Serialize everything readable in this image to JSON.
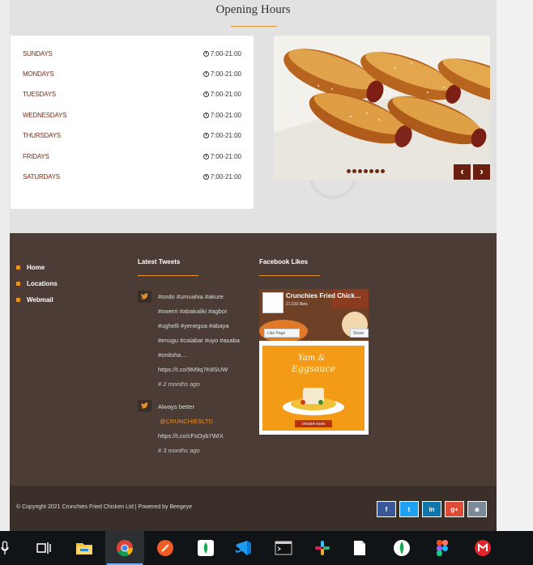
{
  "section_title": "Opening Hours",
  "hours": [
    {
      "day": "SUNDAYS",
      "time": "7:00-21:00"
    },
    {
      "day": "MONDAYS",
      "time": "7:00-21:00"
    },
    {
      "day": "TUESDAYS",
      "time": "7:00-21:00"
    },
    {
      "day": "WEDNESDAYS",
      "time": "7:00-21:00"
    },
    {
      "day": "THURSDAYS",
      "time": "7:00-21:00"
    },
    {
      "day": "FRIDAYS",
      "time": "7:00-21:00"
    },
    {
      "day": "SATURDAYS",
      "time": "7:00-21:00"
    }
  ],
  "slider": {
    "prev": "‹",
    "next": "›",
    "slide_count": 7
  },
  "footer": {
    "nav": [
      {
        "label": "Home"
      },
      {
        "label": "Locations"
      },
      {
        "label": "Webmail"
      }
    ],
    "tweets_heading": "Latest Tweets",
    "tweets": [
      {
        "lines": [
          "#ondo #umuahia #akure",
          "#owerri #abakaliki #agbor",
          "#ughelli #yenegoa #abaya",
          "#enugu #calabar #uyo #asaba",
          "#onitsha…",
          "https://t.co/9M9q7K8SUW"
        ],
        "ago": "# 2 months ago"
      },
      {
        "lines": [
          "Always better",
          "@CRUNCHIESLTD",
          "https://t.co/cFsOyb7WIX"
        ],
        "ago": "# 3 months ago"
      }
    ],
    "facebook_heading": "Facebook Likes",
    "facebook": {
      "page_name": "Crunchies Fried Chick…",
      "likes": "21,510 likes",
      "like_button": "Like Page",
      "share_button": "Share",
      "post_title_1": "Yam &",
      "post_title_2": "Eggsauce",
      "post_button": "ORDER NOW"
    }
  },
  "bottom": {
    "copyright": "© Copyright 2021 Crunchies Fried Chicken Ltd | Powered by Beegeye",
    "social": [
      {
        "name": "facebook",
        "glyph": "f",
        "color": "#3b5998"
      },
      {
        "name": "twitter",
        "glyph": "t",
        "color": "#1da1f2"
      },
      {
        "name": "linkedin",
        "glyph": "in",
        "color": "#0e76a8"
      },
      {
        "name": "google-plus",
        "glyph": "g+",
        "color": "#dd4b39"
      },
      {
        "name": "instagram",
        "glyph": "◙",
        "color": "#7a8a99"
      }
    ]
  },
  "taskbar": [
    {
      "name": "task-view-icon"
    },
    {
      "name": "file-explorer-icon"
    },
    {
      "name": "chrome-icon",
      "active": true
    },
    {
      "name": "postman-icon"
    },
    {
      "name": "mongodb-compass-icon"
    },
    {
      "name": "vscode-icon"
    },
    {
      "name": "terminal-icon"
    },
    {
      "name": "slack-icon"
    },
    {
      "name": "notepad-icon"
    },
    {
      "name": "mongodb-icon"
    },
    {
      "name": "figma-icon"
    },
    {
      "name": "gmail-icon"
    }
  ],
  "colors": {
    "accent": "#e8902b",
    "maroon": "#7a2b14",
    "footer_bg": "#4b3d36",
    "bottom_bg": "#3a2f29"
  }
}
